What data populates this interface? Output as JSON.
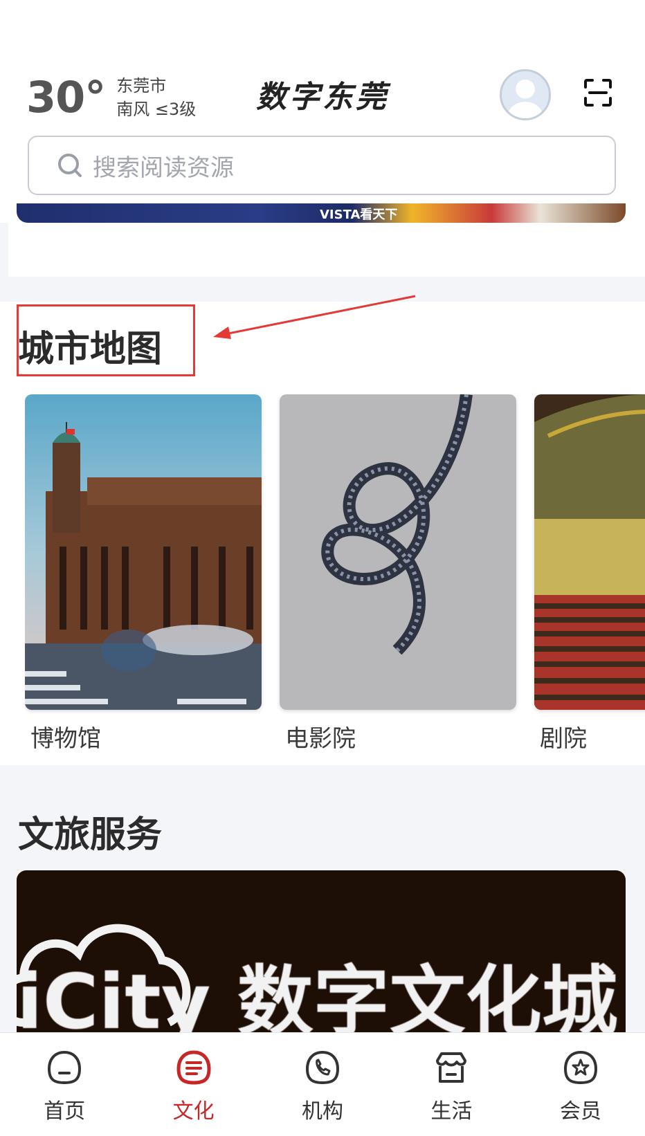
{
  "weather": {
    "temperature": "30°",
    "city": "东莞市",
    "wind": "南风 ≤3级"
  },
  "app": {
    "brand": "数字东莞"
  },
  "search": {
    "placeholder": "搜索阅读资源"
  },
  "banner": {
    "text": "VISTA看天下"
  },
  "city_map": {
    "title": "城市地图",
    "cards": [
      {
        "label": "博物馆"
      },
      {
        "label": "电影院"
      },
      {
        "label": "剧院"
      }
    ]
  },
  "travel": {
    "title": "文旅服务",
    "banner_text": "iCity 数字文化城"
  },
  "tabbar": {
    "items": [
      {
        "label": "首页",
        "active": false
      },
      {
        "label": "文化",
        "active": true
      },
      {
        "label": "机构",
        "active": false
      },
      {
        "label": "生活",
        "active": false
      },
      {
        "label": "会员",
        "active": false
      }
    ]
  },
  "colors": {
    "accent": "#c62828",
    "annotation": "#e53935",
    "page_bg": "#f4f5f9"
  }
}
